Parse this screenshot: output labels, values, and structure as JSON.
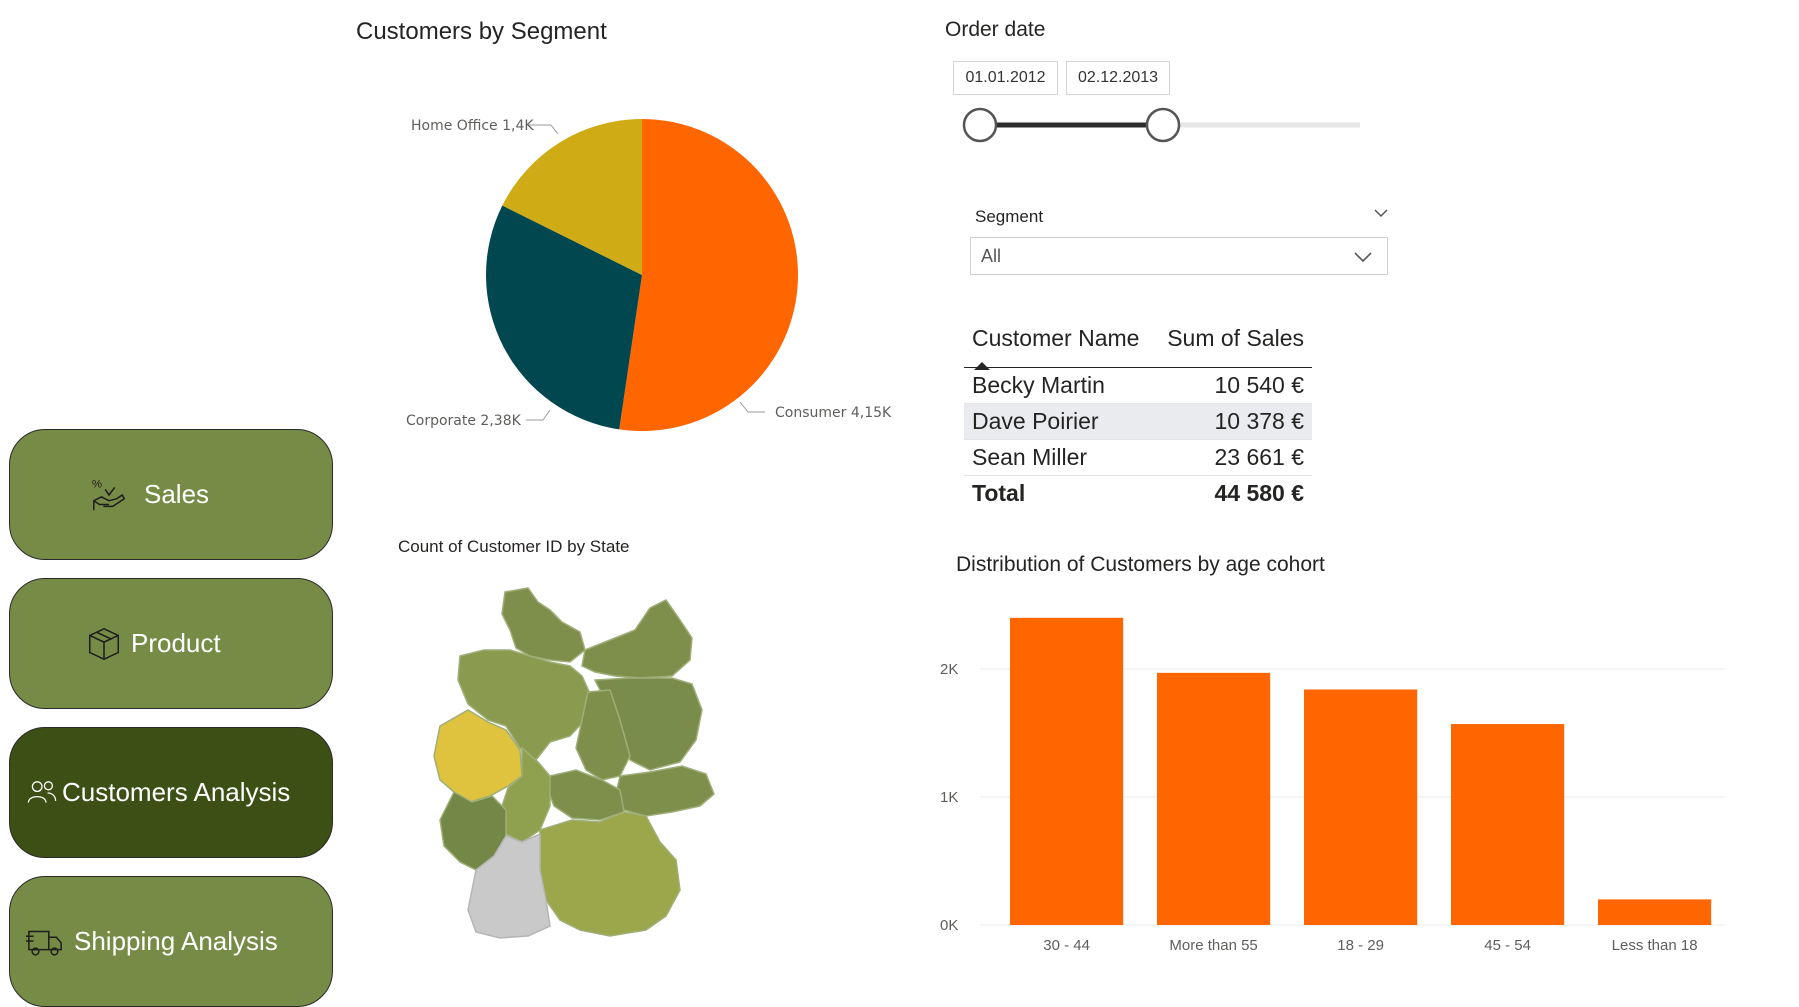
{
  "nav": {
    "items": [
      {
        "label": "Sales",
        "icon": "hand-percent-icon",
        "active": false
      },
      {
        "label": "Product",
        "icon": "box-icon",
        "active": false
      },
      {
        "label": "Customers Analysis",
        "icon": "users-icon",
        "active": true
      },
      {
        "label": "Shipping Analysis",
        "icon": "truck-icon",
        "active": false
      }
    ]
  },
  "pie": {
    "title": "Customers by Segment",
    "labels": {
      "home_office": "Home Office 1,4K",
      "corporate": "Corporate 2,38K",
      "consumer": "Consumer 4,15K"
    }
  },
  "map": {
    "title": "Count of Customer ID by State"
  },
  "date_slicer": {
    "title": "Order date",
    "start": "01.01.2012",
    "end": "02.12.2013"
  },
  "segment_slicer": {
    "title": "Segment",
    "selected": "All"
  },
  "table": {
    "headers": [
      "Customer Name",
      "Sum of Sales"
    ],
    "rows": [
      {
        "name": "Becky Martin",
        "sales": "10 540 €"
      },
      {
        "name": "Dave Poirier",
        "sales": "10 378 €"
      },
      {
        "name": "Sean Miller",
        "sales": "23 661 €"
      }
    ],
    "total_label": "Total",
    "total_value": "44 580 €"
  },
  "colors": {
    "nav_default": "#768b46",
    "nav_active": "#3c4f14",
    "consumer": "#ff6600",
    "corporate": "#004750",
    "home_office": "#cfab16",
    "bar": "#ff6600"
  },
  "chart_data": [
    {
      "type": "pie",
      "title": "Customers by Segment",
      "slices": [
        {
          "name": "Consumer",
          "value": 4150,
          "label": "Consumer 4,15K"
        },
        {
          "name": "Corporate",
          "value": 2380,
          "label": "Corporate 2,38K"
        },
        {
          "name": "Home Office",
          "value": 1400,
          "label": "Home Office 1,4K"
        }
      ]
    },
    {
      "type": "bar",
      "title": "Distribution of Customers by age cohort",
      "categories": [
        "30 - 44",
        "More than 55",
        "18 - 29",
        "45 - 54",
        "Less than 18"
      ],
      "values": [
        2400,
        1970,
        1840,
        1570,
        200
      ],
      "yticks": [
        "0K",
        "1K",
        "2K"
      ],
      "ylim": [
        0,
        2500
      ],
      "grid": true
    }
  ]
}
